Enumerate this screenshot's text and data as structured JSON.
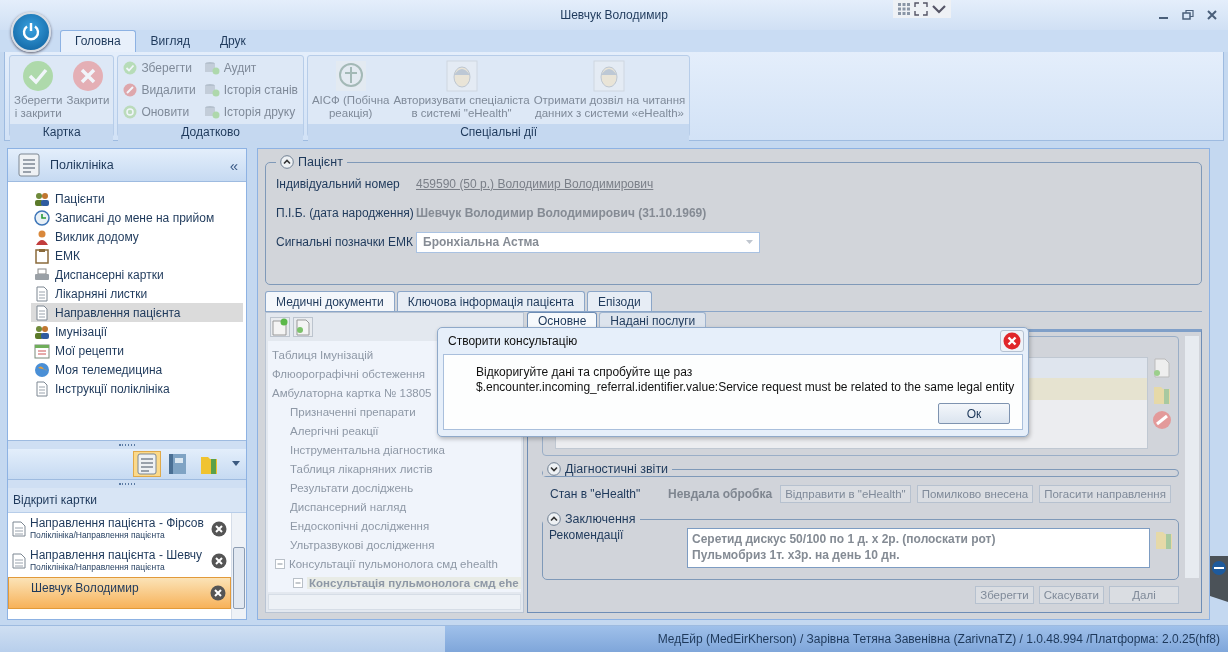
{
  "window": {
    "title": "Шевчук Володимир"
  },
  "ribbon": {
    "tabs": [
      {
        "label": "Головна",
        "selected": true
      },
      {
        "label": "Вигляд",
        "selected": false
      },
      {
        "label": "Друк",
        "selected": false
      }
    ],
    "groups": [
      {
        "label": "Картка",
        "kind": "large",
        "buttons": [
          {
            "label": "Зберегти\nі закрити",
            "disabled": true
          },
          {
            "label": "Закрити",
            "disabled": true
          }
        ]
      },
      {
        "label": "Додатково",
        "kind": "small",
        "buttons": [
          {
            "label": "Зберегти",
            "disabled": true
          },
          {
            "label": "Видалити",
            "disabled": true
          },
          {
            "label": "Оновити",
            "disabled": true
          },
          {
            "label": "Аудит",
            "disabled": true
          },
          {
            "label": "Історія станів",
            "disabled": true
          },
          {
            "label": "Історія друку",
            "disabled": true
          }
        ]
      },
      {
        "label": "Спеціальні дії",
        "kind": "large",
        "buttons": [
          {
            "label": "АІСФ (Побічна\nреакція)",
            "disabled": true
          },
          {
            "label": "Авторизувати спеціаліста\nв системі \"eHealth\"",
            "disabled": true
          },
          {
            "label": "Отримати дозвіл на читання\nданних з системи «eHealth»",
            "disabled": true
          }
        ]
      }
    ]
  },
  "sidebar": {
    "title": "Поліклініка",
    "collapse": "«",
    "items": [
      {
        "label": "Пацієнти",
        "selected": false
      },
      {
        "label": "Записані до мене на прийом",
        "selected": false
      },
      {
        "label": "Виклик додому",
        "selected": false
      },
      {
        "label": "ЕМК",
        "selected": false
      },
      {
        "label": "Диспансерні картки",
        "selected": false
      },
      {
        "label": "Лікарняні листки",
        "selected": false
      },
      {
        "label": "Направлення пацієнта",
        "selected": true
      },
      {
        "label": "Імунізації",
        "selected": false
      },
      {
        "label": "Мої рецепти",
        "selected": false
      },
      {
        "label": "Моя телемедицина",
        "selected": false
      },
      {
        "label": "Інструкції поліклініка",
        "selected": false
      }
    ],
    "views": [
      {
        "selected": true
      },
      {
        "selected": false
      },
      {
        "selected": false
      }
    ]
  },
  "open_cards": {
    "title": "Відкриті картки",
    "items": [
      {
        "title": "Направлення пацієнта - Фірсов",
        "path": "Поліклініка/Направлення пацієнта",
        "selected": false
      },
      {
        "title": "Направлення пацієнта - Шевчу",
        "path": "Поліклініка/Направлення пацієнта",
        "selected": false
      },
      {
        "title": "Шевчук Володимир",
        "selected": true
      }
    ]
  },
  "patient": {
    "title": "Пацієнт",
    "expanded": true,
    "fields": [
      {
        "label": "Індивідуальний номер",
        "value": "459590 (50 р.) Володимир Володимирович",
        "kind": "link"
      },
      {
        "label": "П.І.Б. (дата народження)",
        "value": "Шевчук Володимир Володимирович (31.10.1969)",
        "kind": "text"
      },
      {
        "label": "Сигнальні позначки ЕМК",
        "value": "Бронхіальна Астма",
        "kind": "combo"
      }
    ]
  },
  "doc_tabs": [
    {
      "label": "Медичні документи",
      "selected": true
    },
    {
      "label": "Ключова інформація пацієнта",
      "selected": false
    },
    {
      "label": "Епізоди",
      "selected": false
    }
  ],
  "tree": {
    "disabled": true,
    "items": [
      {
        "label": "Таблиця Імунізацій"
      },
      {
        "label": "Флюорографічні обстеження"
      },
      {
        "label": "Амбулаторна картка № 13805",
        "children": [
          {
            "label": "Призначенні препарати"
          },
          {
            "label": "Алергічні реакції"
          },
          {
            "label": "Інструментальна діагностика"
          },
          {
            "label": "Таблиця лікарняних листів"
          },
          {
            "label": "Результати досліджень"
          },
          {
            "label": "Диспансерний нагляд"
          },
          {
            "label": "Ендоскопічні дослідження"
          },
          {
            "label": "Ультразвукові дослідження"
          },
          {
            "label": "Консультації пульмонолога смд ehealth",
            "expanded": true,
            "children": [
              {
                "label": "Консультація пульмонолога смд ehe",
                "selected": true
              }
            ]
          }
        ]
      }
    ]
  },
  "sub_tabs": [
    {
      "label": "Основне",
      "selected": true
    },
    {
      "label": "Надані послуги",
      "selected": false
    }
  ],
  "diagnostics": {
    "title": "Діагностичні звіти",
    "expanded": false
  },
  "ehealth": {
    "label": "Стан в \"eHealth\"",
    "value": "Невдала обробка",
    "buttons": [
      {
        "label": "Відправити в \"eHealth\"",
        "disabled": true
      },
      {
        "label": "Помилково внесена",
        "disabled": true
      },
      {
        "label": "Погасити направлення",
        "disabled": true
      }
    ]
  },
  "conclusion": {
    "title": "Заключення",
    "expanded": true,
    "label": "Рекомендації",
    "lines": [
      "Серетид дискус 50/100 по 1 д. х 2р. (полоскати рот)",
      "Пульмобриз 1т. х3р. на день 10 дн."
    ]
  },
  "footer_buttons": [
    {
      "label": "Зберегти",
      "disabled": true
    },
    {
      "label": "Скасувати",
      "disabled": true
    },
    {
      "label": "Далі",
      "disabled": true
    }
  ],
  "dialog": {
    "title": "Створити консультацію",
    "lines": [
      "Відкоригуйте дані та спробуйте ще раз",
      "$.encounter.incoming_referral.identifier.value:Service request must be related to the same legal entity"
    ],
    "button": "Ок"
  },
  "status_bar": "МедЕйр (MedEirKherson) / Зарівна Тетяна Завенівна (ZarivnaTZ) / 1.0.48.994 /Платформа: 2.0.25(hf8)"
}
